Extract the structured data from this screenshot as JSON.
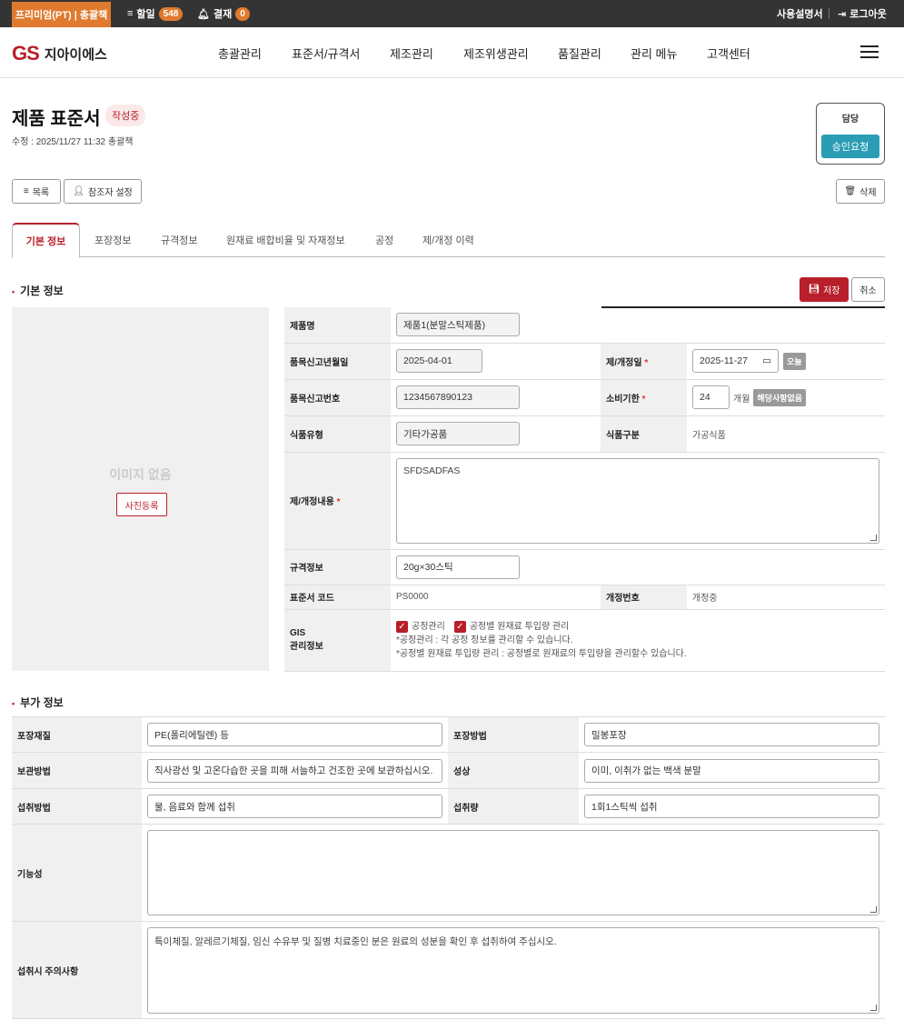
{
  "topbar": {
    "plan": "프리미엄(PT) | 총괄책",
    "todo_label": "할일",
    "todo_count": "548",
    "approval_label": "결재",
    "approval_count": "0",
    "manual": "사용설명서",
    "logout": "로그아웃"
  },
  "header": {
    "brand_mark": "GS",
    "brand": "지아이에스",
    "nav": [
      "총괄관리",
      "표준서/규격서",
      "제조관리",
      "제조위생관리",
      "품질관리",
      "관리 메뉴",
      "고객센터"
    ]
  },
  "page": {
    "title": "제품 표준서",
    "status": "작성중",
    "modified": "수정 : 2025/11/27 11:32  총괄책",
    "approver_label": "담당",
    "approve_request": "승인요청",
    "list_btn": "목록",
    "ref_btn": "참조자 설정",
    "delete_btn": "삭제"
  },
  "tabs": [
    "기본 정보",
    "포장정보",
    "규격정보",
    "원재료 배합비율 및 자재정보",
    "공정",
    "제/개정 이력"
  ],
  "basic": {
    "section": "기본 정보",
    "save": "저장",
    "cancel": "취소",
    "no_image": "이미지 없음",
    "photo_btn": "사진등록",
    "product_name_label": "제품명",
    "product_name": "제품1(분말스틱제품)",
    "report_date_label": "품목신고년월일",
    "report_date": "2025-04-01",
    "revision_date_label": "제/개정일",
    "revision_date": "2025-11-27",
    "today_btn": "오늘",
    "report_no_label": "품목신고번호",
    "report_no": "1234567890123",
    "shelf_label": "소비기한",
    "shelf_value": "24",
    "shelf_unit": "개월",
    "na_btn": "해당사항없음",
    "food_type_label": "식품유형",
    "food_type": "기타가공품",
    "food_class_label": "식품구분",
    "food_class": "가공식품",
    "revision_content_label": "제/개정내용",
    "revision_content": "SFDSADFAS",
    "spec_label": "규격정보",
    "spec": "20g×30스틱",
    "code_label": "표준서 코드",
    "code": "PS0000",
    "rev_no_label": "개정번호",
    "rev_no": "개정중",
    "gis_label_1": "GIS",
    "gis_label_2": "관리정보",
    "cb1": "공정관리",
    "cb2": "공정별 원재료 투입량 관리",
    "note1": "*공정관리 : 각 공정 정보를 관리할 수 있습니다.",
    "note2": "*공정별 원재료 투입량 관리 : 공정별로 원재료의 투입량을 관리할수 있습니다."
  },
  "extra": {
    "section": "부가 정보",
    "pack_material_label": "포장재질",
    "pack_material": "PE(폴리에틸렌) 등",
    "pack_method_label": "포장방법",
    "pack_method": "밀봉포장",
    "storage_label": "보관방법",
    "storage": "직사광선 및 고온다습한 곳을 피해 서늘하고 건조한 곳에 보관하십시오.",
    "appearance_label": "성상",
    "appearance": "이미, 이취가 없는 백색 분말",
    "intake_method_label": "섭취방법",
    "intake_method": "물, 음료와 함께 섭취",
    "intake_amount_label": "섭취량",
    "intake_amount": "1회1스틱씩 섭취",
    "function_label": "기능성",
    "function": "",
    "caution_label": "섭취시 주의사항",
    "caution": "특이체질, 알레르기체질, 임신 수유부 및 질병 치료중인 분은 원료의 성분을 확인 후 섭취하여 주십시오."
  }
}
